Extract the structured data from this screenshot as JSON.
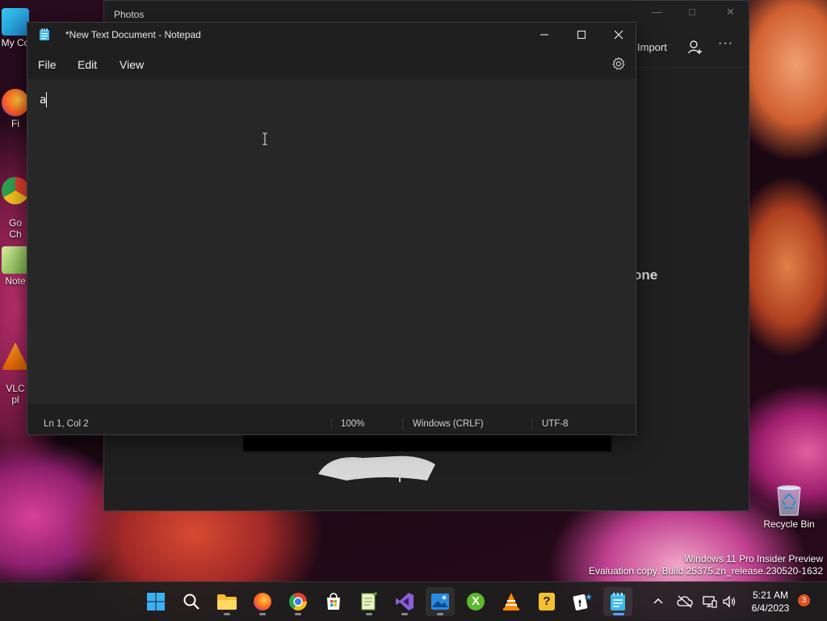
{
  "desktop": {
    "icons": [
      {
        "label": "My Co",
        "name": "this-pc"
      },
      {
        "label": "Fi",
        "name": "firefox"
      },
      {
        "label": "Go\nCh",
        "name": "google-chrome"
      },
      {
        "label": "Note",
        "name": "notepad-plus-plus"
      },
      {
        "label": "VLC\npl",
        "name": "vlc-media-player"
      }
    ],
    "recycle_bin": "Recycle Bin",
    "watermark_line1": "Windows 11 Pro Insider Preview",
    "watermark_line2": "Evaluation copy. Build 25375.zn_release.230520-1632"
  },
  "photos": {
    "title": "Photos",
    "import_label": "Import",
    "partial_heading": "one"
  },
  "notepad": {
    "title": "*New Text Document - Notepad",
    "menus": [
      "File",
      "Edit",
      "View"
    ],
    "content": "a",
    "status": {
      "position": "Ln 1, Col 2",
      "zoom": "100%",
      "line_endings": "Windows (CRLF)",
      "encoding": "UTF-8"
    }
  },
  "taskbar": {
    "apps": [
      {
        "name": "start-button",
        "icon": "windows-logo"
      },
      {
        "name": "search-button",
        "icon": "search-icon"
      },
      {
        "name": "file-explorer",
        "icon": "folder-icon"
      },
      {
        "name": "firefox",
        "icon": "firefox-icon"
      },
      {
        "name": "chrome",
        "icon": "chrome-icon"
      },
      {
        "name": "microsoft-store",
        "icon": "store-icon"
      },
      {
        "name": "notepad-plus-plus",
        "icon": "notepadpp-icon"
      },
      {
        "name": "visual-studio",
        "icon": "vs-icon"
      },
      {
        "name": "photos",
        "icon": "photos-icon"
      },
      {
        "name": "xbox",
        "icon": "xbox-icon"
      },
      {
        "name": "vlc",
        "icon": "vlc-icon"
      },
      {
        "name": "tips",
        "icon": "tips-icon"
      },
      {
        "name": "solitaire",
        "icon": "solitaire-icon"
      },
      {
        "name": "notepad",
        "icon": "notepad-icon"
      }
    ],
    "time": "5:21 AM",
    "date": "6/4/2023",
    "notification_count": "3"
  },
  "colors": {
    "accent": "#5aa0ff",
    "window_bg": "#1f1f1f",
    "editor_bg": "#272727",
    "badge": "#e05020"
  }
}
